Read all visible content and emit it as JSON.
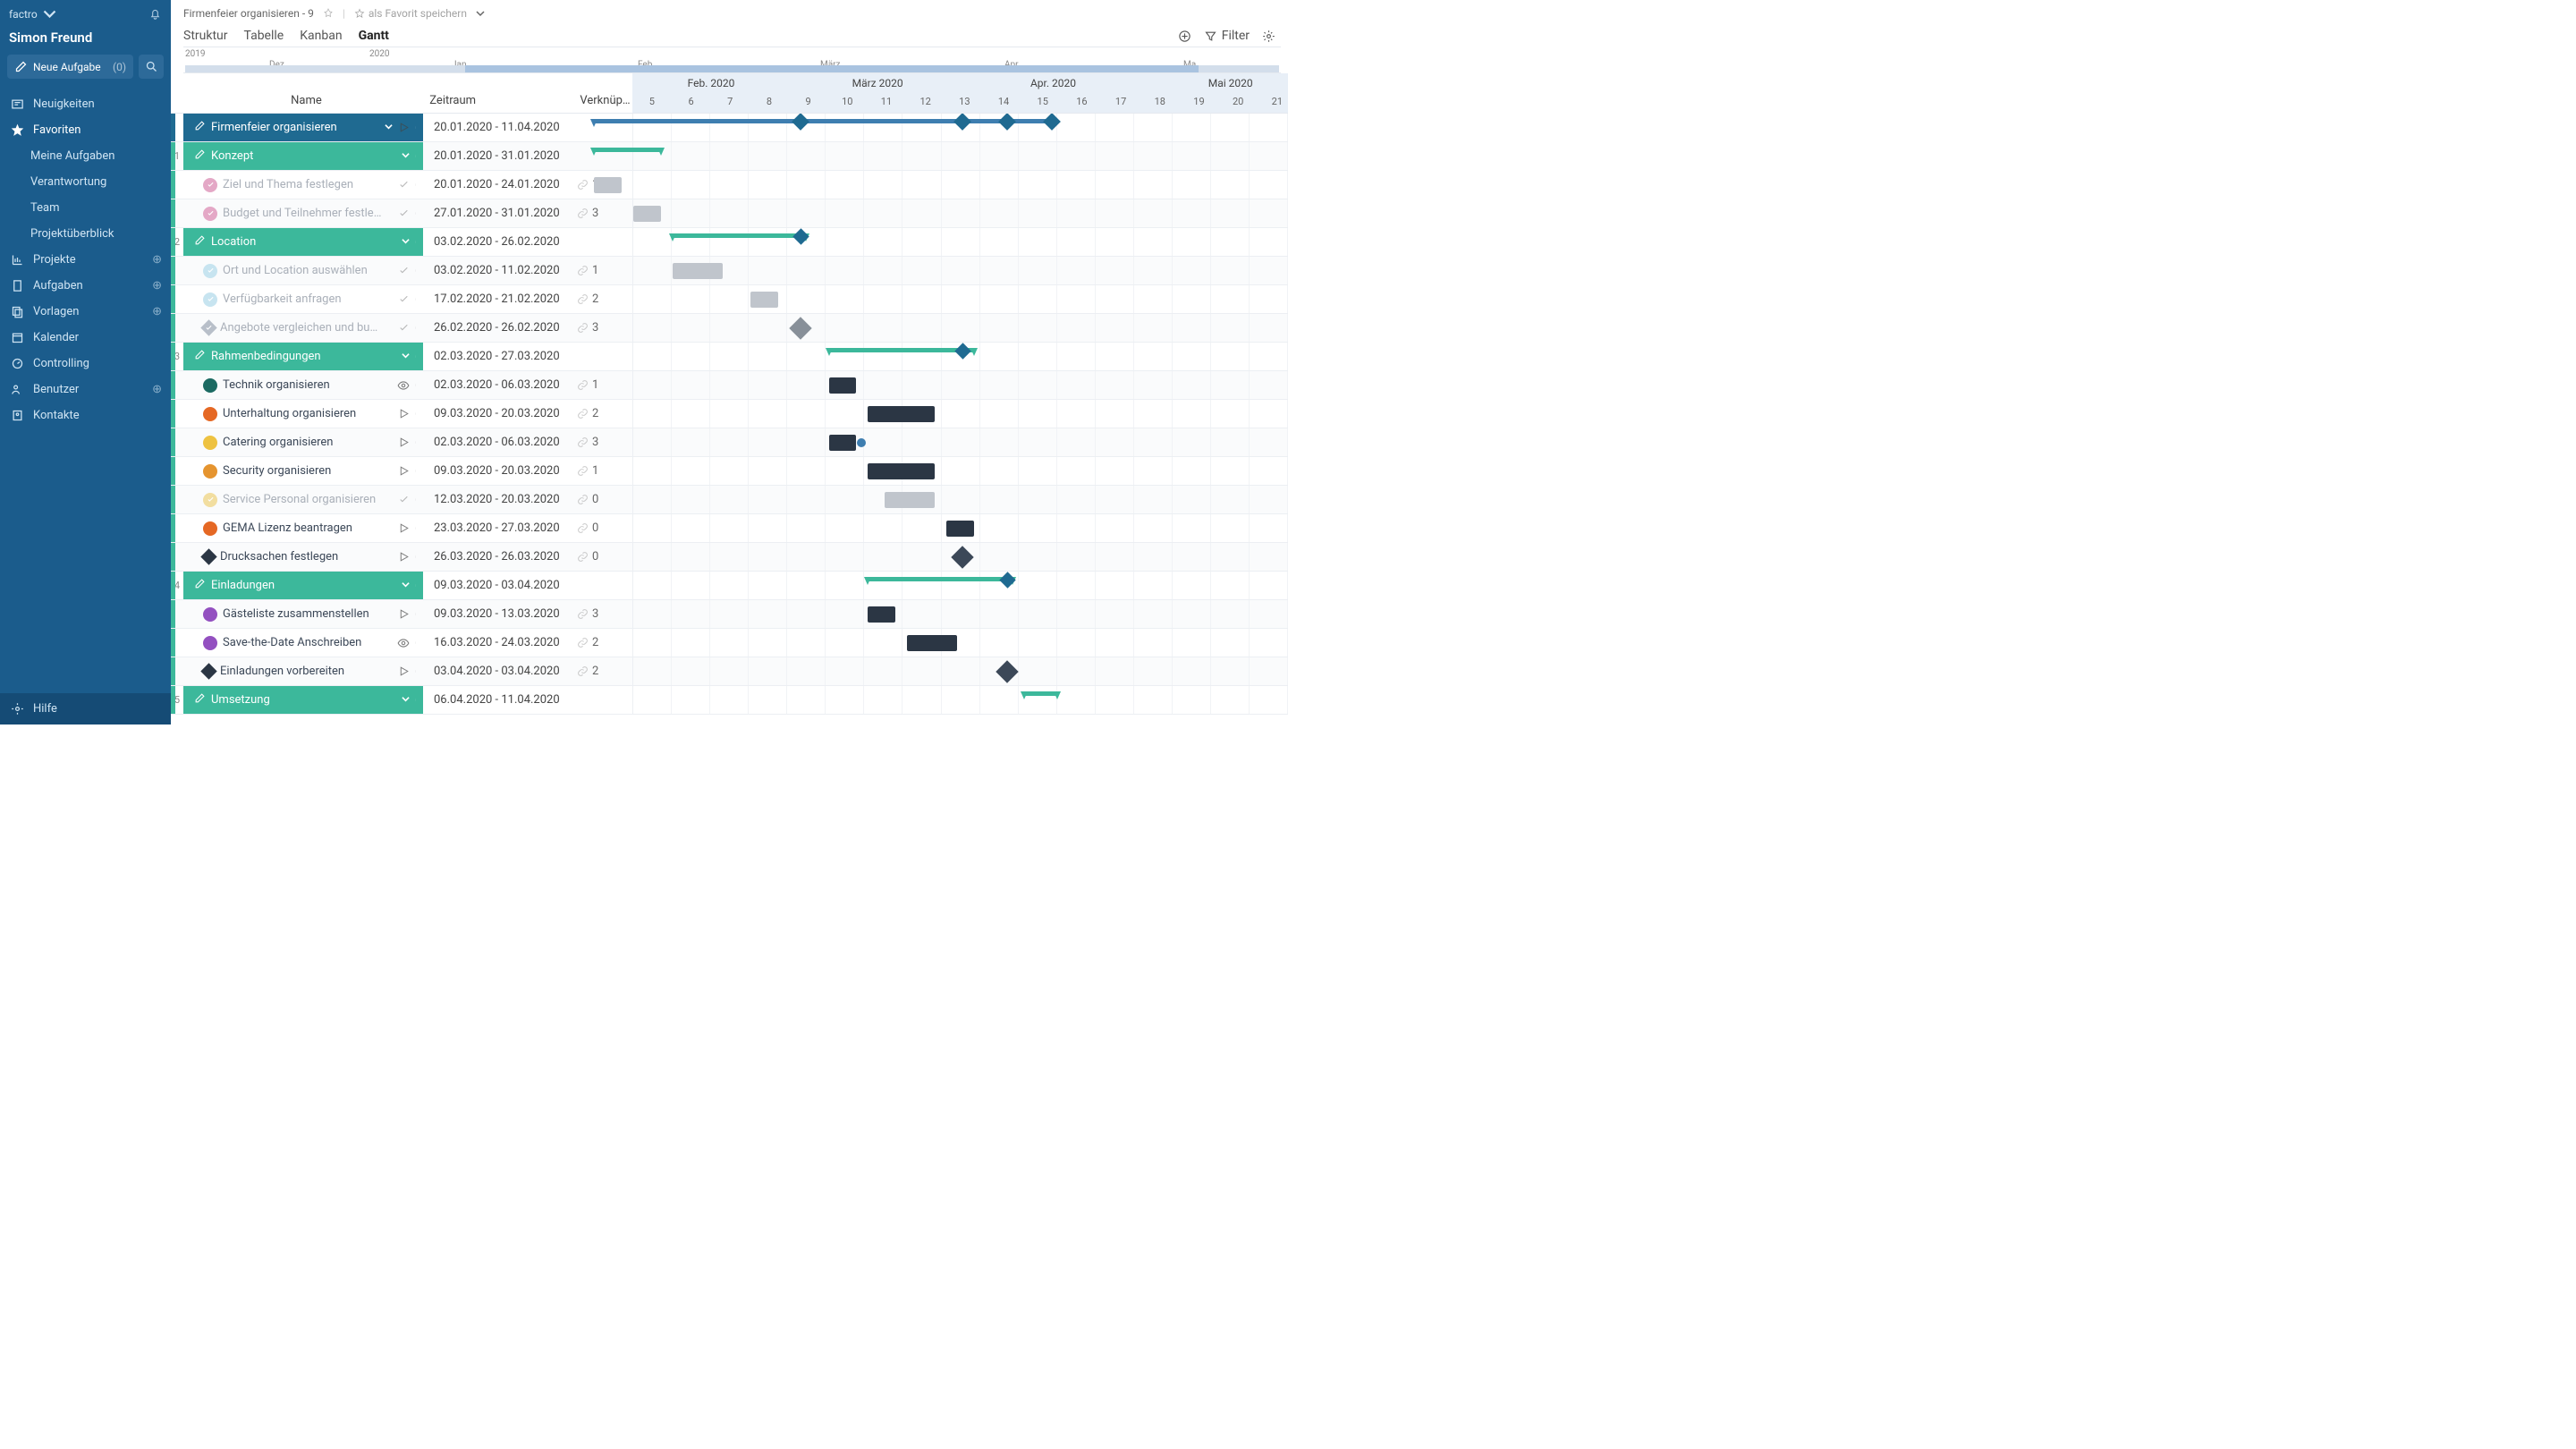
{
  "brand": "factro",
  "user": "Simon Freund",
  "newTask": "Neue Aufgabe",
  "newTaskCount": "(0)",
  "nav": {
    "neuigkeiten": "Neuigkeiten",
    "favoriten": "Favoriten",
    "meineAufgaben": "Meine Aufgaben",
    "verantwortung": "Verantwortung",
    "team": "Team",
    "projektueberblick": "Projektüberblick",
    "projekte": "Projekte",
    "aufgaben": "Aufgaben",
    "vorlagen": "Vorlagen",
    "kalender": "Kalender",
    "controlling": "Controlling",
    "benutzer": "Benutzer",
    "kontakte": "Kontakte",
    "hilfe": "Hilfe"
  },
  "crumb": {
    "title": "Firmenfeier organisieren - 9",
    "fav": "als Favorit speichern"
  },
  "tabs": {
    "struktur": "Struktur",
    "tabelle": "Tabelle",
    "kanban": "Kanban",
    "gantt": "Gantt",
    "filter": "Filter"
  },
  "miniTimeline": {
    "y2019": "2019",
    "y2020": "2020",
    "dez": "Dez.",
    "jan": "Jan.",
    "feb": "Feb.",
    "maerz": "März",
    "apr": "Apr.",
    "mai": "Ma"
  },
  "hdr": {
    "name": "Name",
    "zeitraum": "Zeitraum",
    "verknuepfung": "Verknüpfungen",
    "months": [
      "Feb. 2020",
      "März 2020",
      "Apr. 2020",
      "Mai 2020"
    ],
    "weeks": [
      "5",
      "6",
      "7",
      "8",
      "9",
      "10",
      "11",
      "12",
      "13",
      "14",
      "15",
      "16",
      "17",
      "18",
      "19",
      "20",
      "21"
    ]
  },
  "rows": [
    {
      "num": "",
      "type": "root",
      "name": "Firmenfeier organisieren",
      "date": "20.01.2020 - 11.04.2020",
      "link": "",
      "ctrl": "play"
    },
    {
      "num": "1",
      "type": "grp",
      "name": "Konzept",
      "date": "20.01.2020 - 31.01.2020",
      "link": ""
    },
    {
      "num": "",
      "type": "done",
      "name": "Ziel und Thema festlegen",
      "date": "20.01.2020 - 24.01.2020",
      "link": "1",
      "color": "#e4a8c6"
    },
    {
      "num": "",
      "type": "done",
      "name": "Budget und Teilnehmer festle…",
      "date": "27.01.2020 - 31.01.2020",
      "link": "3",
      "color": "#e4a8c6"
    },
    {
      "num": "2",
      "type": "grp",
      "name": "Location",
      "date": "03.02.2020 - 26.02.2020",
      "link": ""
    },
    {
      "num": "",
      "type": "done",
      "name": "Ort und Location auswählen",
      "date": "03.02.2020 - 11.02.2020",
      "link": "1",
      "color": "#c7e4f0"
    },
    {
      "num": "",
      "type": "done",
      "name": "Verfügbarkeit anfragen",
      "date": "17.02.2020 - 21.02.2020",
      "link": "2",
      "color": "#c7e4f0"
    },
    {
      "num": "",
      "type": "ms-done",
      "name": "Angebote vergleichen und bu…",
      "date": "26.02.2020 - 26.02.2020",
      "link": "3",
      "color": "#b8bfc9"
    },
    {
      "num": "3",
      "type": "grp",
      "name": "Rahmenbedingungen",
      "date": "02.03.2020 - 27.03.2020",
      "link": ""
    },
    {
      "num": "",
      "type": "task",
      "name": "Technik organisieren",
      "date": "02.03.2020 - 06.03.2020",
      "link": "1",
      "color": "#1c6a62",
      "ctrl": "eye"
    },
    {
      "num": "",
      "type": "task",
      "name": "Unterhaltung organisieren",
      "date": "09.03.2020 - 20.03.2020",
      "link": "2",
      "color": "#e56824",
      "ctrl": "play"
    },
    {
      "num": "",
      "type": "task",
      "name": "Catering organisieren",
      "date": "02.03.2020 - 06.03.2020",
      "link": "3",
      "color": "#eec241",
      "ctrl": "play"
    },
    {
      "num": "",
      "type": "task",
      "name": "Security organisieren",
      "date": "09.03.2020 - 20.03.2020",
      "link": "1",
      "color": "#e5942f",
      "ctrl": "play"
    },
    {
      "num": "",
      "type": "done",
      "name": "Service Personal organisieren",
      "date": "12.03.2020 - 20.03.2020",
      "link": "0",
      "color": "#f2dea0"
    },
    {
      "num": "",
      "type": "task",
      "name": "GEMA Lizenz beantragen",
      "date": "23.03.2020 - 27.03.2020",
      "link": "0",
      "color": "#e56824",
      "ctrl": "play"
    },
    {
      "num": "",
      "type": "ms",
      "name": "Drucksachen festlegen",
      "date": "26.03.2020 - 26.03.2020",
      "link": "0",
      "color": "#2b3644",
      "ctrl": "play"
    },
    {
      "num": "4",
      "type": "grp",
      "name": "Einladungen",
      "date": "09.03.2020 - 03.04.2020",
      "link": ""
    },
    {
      "num": "",
      "type": "task",
      "name": "Gästeliste zusammenstellen",
      "date": "09.03.2020 - 13.03.2020",
      "link": "3",
      "color": "#9350c0",
      "ctrl": "play"
    },
    {
      "num": "",
      "type": "task",
      "name": "Save-the-Date Anschreiben",
      "date": "16.03.2020 - 24.03.2020",
      "link": "2",
      "color": "#9350c0",
      "ctrl": "eye"
    },
    {
      "num": "",
      "type": "ms",
      "name": "Einladungen vorbereiten",
      "date": "03.04.2020 - 03.04.2020",
      "link": "2",
      "color": "#2b3644",
      "ctrl": "play"
    },
    {
      "num": "5",
      "type": "grp",
      "name": "Umsetzung",
      "date": "06.04.2020 - 11.04.2020",
      "link": ""
    }
  ],
  "chart_data": {
    "type": "gantt",
    "title": "Firmenfeier organisieren",
    "xrange": [
      "2020-01-20",
      "2020-05-20"
    ],
    "series": [
      {
        "name": "Firmenfeier organisieren",
        "start": "2020-01-20",
        "end": "2020-04-11",
        "group": true,
        "milestones": [
          "2020-02-26",
          "2020-03-26",
          "2020-04-03",
          "2020-04-11"
        ]
      },
      {
        "name": "Konzept",
        "start": "2020-01-20",
        "end": "2020-01-31",
        "group": true
      },
      {
        "name": "Ziel und Thema festlegen",
        "start": "2020-01-20",
        "end": "2020-01-24"
      },
      {
        "name": "Budget und Teilnehmer festlegen",
        "start": "2020-01-27",
        "end": "2020-01-31"
      },
      {
        "name": "Location",
        "start": "2020-02-03",
        "end": "2020-02-26",
        "group": true
      },
      {
        "name": "Ort und Location auswählen",
        "start": "2020-02-03",
        "end": "2020-02-11"
      },
      {
        "name": "Verfügbarkeit anfragen",
        "start": "2020-02-17",
        "end": "2020-02-21"
      },
      {
        "name": "Angebote vergleichen und buchen",
        "start": "2020-02-26",
        "end": "2020-02-26",
        "milestone": true
      },
      {
        "name": "Rahmenbedingungen",
        "start": "2020-03-02",
        "end": "2020-03-27",
        "group": true
      },
      {
        "name": "Technik organisieren",
        "start": "2020-03-02",
        "end": "2020-03-06"
      },
      {
        "name": "Unterhaltung organisieren",
        "start": "2020-03-09",
        "end": "2020-03-20"
      },
      {
        "name": "Catering organisieren",
        "start": "2020-03-02",
        "end": "2020-03-06"
      },
      {
        "name": "Security organisieren",
        "start": "2020-03-09",
        "end": "2020-03-20"
      },
      {
        "name": "Service Personal organisieren",
        "start": "2020-03-12",
        "end": "2020-03-20"
      },
      {
        "name": "GEMA Lizenz beantragen",
        "start": "2020-03-23",
        "end": "2020-03-27"
      },
      {
        "name": "Drucksachen festlegen",
        "start": "2020-03-26",
        "end": "2020-03-26",
        "milestone": true
      },
      {
        "name": "Einladungen",
        "start": "2020-03-09",
        "end": "2020-04-03",
        "group": true
      },
      {
        "name": "Gästeliste zusammenstellen",
        "start": "2020-03-09",
        "end": "2020-03-13"
      },
      {
        "name": "Save-the-Date Anschreiben",
        "start": "2020-03-16",
        "end": "2020-03-24"
      },
      {
        "name": "Einladungen vorbereiten",
        "start": "2020-04-03",
        "end": "2020-04-03",
        "milestone": true
      },
      {
        "name": "Umsetzung",
        "start": "2020-04-06",
        "end": "2020-04-11",
        "group": true
      }
    ]
  }
}
